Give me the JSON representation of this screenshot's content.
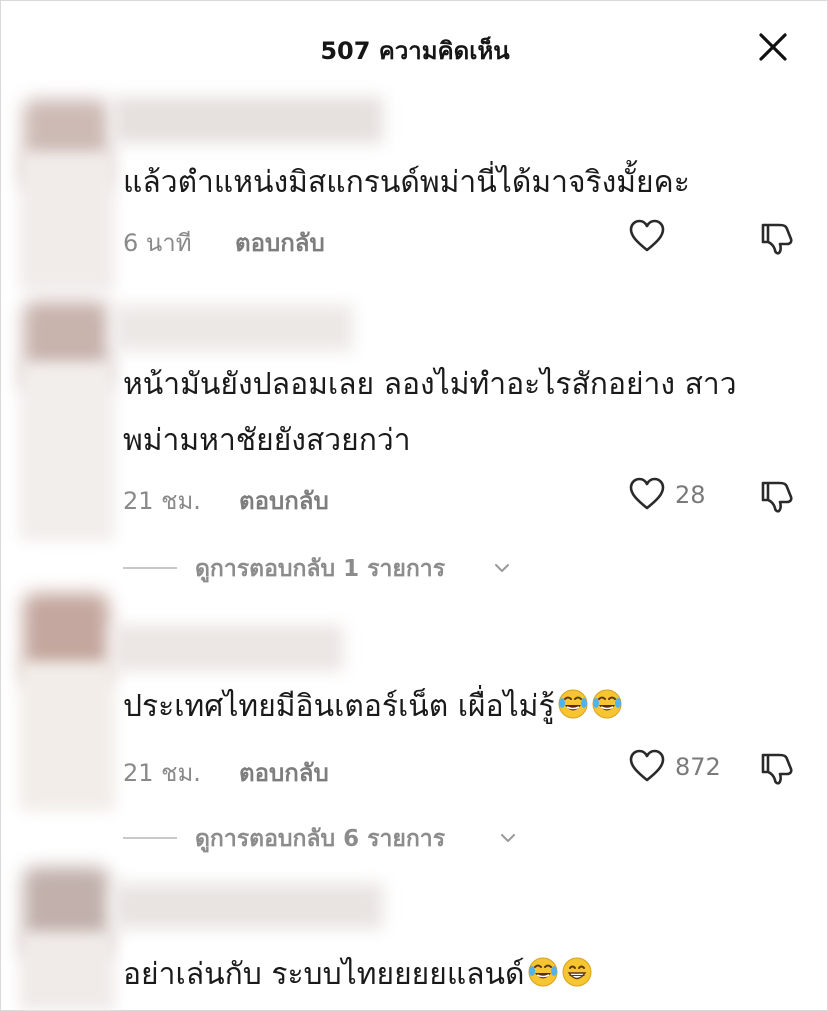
{
  "header": {
    "title": "507 ความคิดเห็น",
    "close_icon": "close-icon"
  },
  "comments": [
    {
      "text": "แล้วตำแหน่งมิสแกรนด์พม่านี่ได้มาจริงมั้ยคะ",
      "time": "6 นาที",
      "reply_label": "ตอบกลับ",
      "likes": "",
      "like_icon": "heart-icon",
      "dislike_icon": "thumbs-down-icon"
    },
    {
      "text_line1": "หน้ามันยังปลอมเลย ลองไม่ทำอะไรสักอย่าง สาว",
      "text_line2": "พม่ามหาชัยยังสวยกว่า",
      "time": "21 ชม.",
      "reply_label": "ตอบกลับ",
      "likes": "28",
      "view_replies": "ดูการตอบกลับ 1 รายการ",
      "like_icon": "heart-icon",
      "dislike_icon": "thumbs-down-icon"
    },
    {
      "text": "ประเทศไทยมีอินเตอร์เน็ต เผื่อไม่รู้",
      "emojis": [
        "face-with-tears-of-joy-emoji",
        "face-with-tears-of-joy-emoji"
      ],
      "time": "21 ชม.",
      "reply_label": "ตอบกลับ",
      "likes": "872",
      "view_replies": "ดูการตอบกลับ 6 รายการ",
      "like_icon": "heart-icon",
      "dislike_icon": "thumbs-down-icon"
    },
    {
      "text": "อย่าเล่นกับ ระบบไทยยยยแลนด์",
      "emojis": [
        "face-with-tears-of-joy-emoji",
        "grinning-face-emoji"
      ]
    }
  ],
  "colors": {
    "text": "#1a1a1a",
    "meta": "#8a8a8a",
    "icon": "#2a2a2a",
    "emoji_yellow": "#f7c531"
  }
}
